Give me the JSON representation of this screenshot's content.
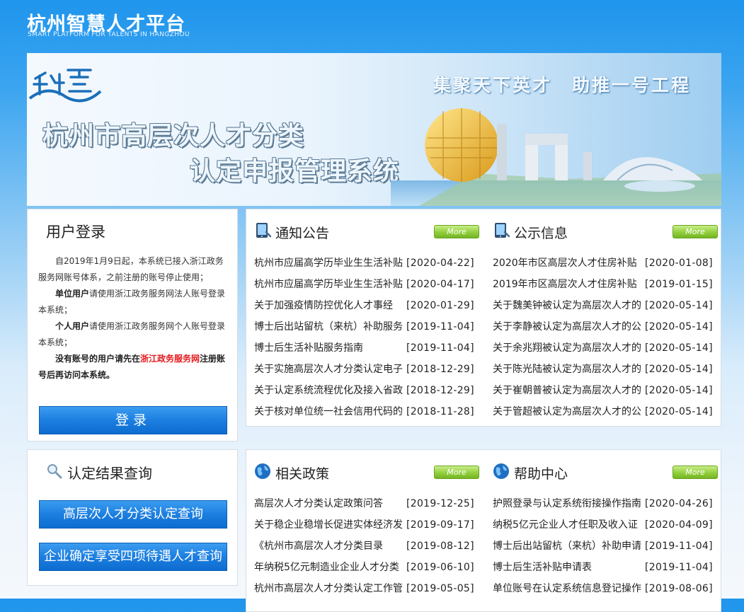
{
  "header": {
    "logo_cn": "杭州智慧人才平台",
    "logo_en": "SMART PLATFORM FOR TALENTS IN HANGZHOU"
  },
  "banner": {
    "title_line1": "杭州市高层次人才分类",
    "title_line2": "认定申报管理系统",
    "slogan": "集聚天下英才　助推一号工程"
  },
  "login": {
    "title": "用户登录",
    "para1": "自2019年1月9日起，本系统已接入浙江政务服务网账号体系，之前注册的账号停止使用；",
    "para2_bold": "单位用户",
    "para2_rest": "请使用浙江政务服务网法人账号登录本系统；",
    "para3_bold": "个人用户",
    "para3_rest": "请使用浙江政务服务网个人账号登录本系统；",
    "para4_a": "没有账号的用户请先在",
    "para4_link": "浙江政务服务网",
    "para4_b": "注册账号后再访问本系统。",
    "button": "登录"
  },
  "query": {
    "title": "认定结果查询",
    "button1": "高层次人才分类认定查询",
    "button2": "企业确定享受四项待遇人才查询"
  },
  "more_label": "More",
  "sections": {
    "notice": {
      "title": "通知公告",
      "items": [
        {
          "title": "杭州市应届高学历毕业生生活补贴",
          "date": "[2020-04-22]"
        },
        {
          "title": "杭州市应届高学历毕业生生活补贴",
          "date": "[2020-04-17]"
        },
        {
          "title": "关于加强疫情防控优化人才事经",
          "date": "[2020-01-29]"
        },
        {
          "title": "博士后出站留杭（来杭）补助服务",
          "date": "[2019-11-04]"
        },
        {
          "title": "博士后生活补贴服务指南",
          "date": "[2019-11-04]"
        },
        {
          "title": "关于实施高层次人才分类认定电子",
          "date": "[2018-12-29]"
        },
        {
          "title": "关于认定系统流程优化及接入省政",
          "date": "[2018-12-29]"
        },
        {
          "title": "关于核对单位统一社会信用代码的",
          "date": "[2018-11-28]"
        }
      ]
    },
    "public": {
      "title": "公示信息",
      "items": [
        {
          "title": "2020年市区高层次人才住房补贴",
          "date": "[2020-01-08]"
        },
        {
          "title": "2019年市区高层次人才住房补贴",
          "date": "[2019-01-15]"
        },
        {
          "title": "关于魏美钟被认定为高层次人才的",
          "date": "[2020-05-14]"
        },
        {
          "title": "关于李静被认定为高层次人才的公",
          "date": "[2020-05-14]"
        },
        {
          "title": "关于余兆翔被认定为高层次人才的",
          "date": "[2020-05-14]"
        },
        {
          "title": "关于陈光陆被认定为高层次人才的",
          "date": "[2020-05-14]"
        },
        {
          "title": "关于崔朝普被认定为高层次人才的",
          "date": "[2020-05-14]"
        },
        {
          "title": "关于管超被认定为高层次人才的公",
          "date": "[2020-05-14]"
        }
      ]
    },
    "policy": {
      "title": "相关政策",
      "items": [
        {
          "title": "高层次人才分类认定政策问答",
          "date": "[2019-12-25]"
        },
        {
          "title": "关于稳企业稳增长促进实体经济发",
          "date": "[2019-09-17]"
        },
        {
          "title": "《杭州市高层次人才分类目录",
          "date": "[2019-08-12]"
        },
        {
          "title": "年纳税5亿元制造业企业人才分类",
          "date": "[2019-06-10]"
        },
        {
          "title": "杭州市高层次人才分类认定工作管",
          "date": "[2019-05-05]"
        }
      ]
    },
    "help": {
      "title": "帮助中心",
      "items": [
        {
          "title": "护照登录与认定系统衔接操作指南",
          "date": "[2020-04-26]"
        },
        {
          "title": "纳税5亿元企业人才任职及收入证",
          "date": "[2020-04-09]"
        },
        {
          "title": "博士后出站留杭（来杭）补助申请",
          "date": "[2019-11-04]"
        },
        {
          "title": "博士后生活补贴申请表",
          "date": "[2019-11-04]"
        },
        {
          "title": "单位账号在认定系统信息登记操作",
          "date": "[2019-08-06]"
        }
      ]
    }
  },
  "colors": {
    "header_blue": "#1f95ec",
    "button_blue": "#1c7fe0",
    "more_green": "#92cf3c",
    "link_red": "#e5161b"
  },
  "icons": {
    "notice": "tablet-icon",
    "public": "tablet-icon",
    "policy": "globe-icon",
    "help": "globe-icon",
    "query": "search-icon"
  }
}
